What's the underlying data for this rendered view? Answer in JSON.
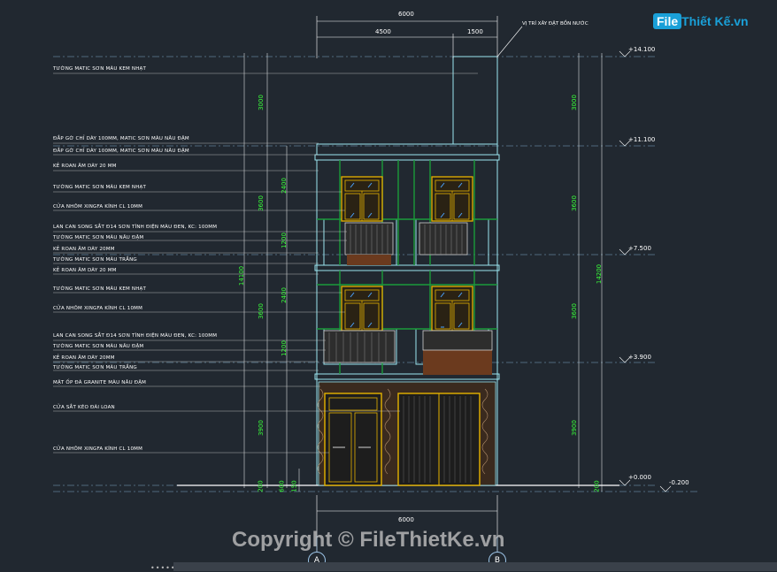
{
  "logo": {
    "file": "File",
    "rest": "Thiết Kế.vn"
  },
  "copyright": "Copyright © FileThietKe.vn",
  "top_note": "VỊ TRÍ XÂY ĐẶT BỒN NƯỚC",
  "dims_top": {
    "overall": "6000",
    "left": "4500",
    "right": "1500"
  },
  "dims_bottom": {
    "overall": "6000"
  },
  "levels": [
    {
      "key": "l14",
      "text": "+14.100"
    },
    {
      "key": "l11",
      "text": "+11.100"
    },
    {
      "key": "l7",
      "text": "+7.500"
    },
    {
      "key": "l3",
      "text": "+3.900"
    },
    {
      "key": "l0",
      "text": "+0.000"
    },
    {
      "key": "lm",
      "text": "-0.200"
    }
  ],
  "vdims_left": [
    "3000",
    "2400",
    "3600",
    "1200",
    "14100",
    "2400",
    "3600",
    "1200",
    "3900",
    "200",
    "600",
    "150"
  ],
  "vdims_right": [
    "3000",
    "3600",
    "3600",
    "3900",
    "14200",
    "200"
  ],
  "axes": {
    "a": "A",
    "b": "B"
  },
  "labels": [
    "TƯỜNG MATIC SƠN MÀU KEM NHẠT",
    "ĐẮP GỜ CHỈ DÀY 100MM, MATIC SƠN MÀU NÂU ĐẬM",
    "ĐẮP GỜ CHỈ DÀY 100MM, MATIC SƠN MÀU NÂU ĐẬM",
    "KẺ ROAN ÂM DÀY 20 MM",
    "TƯỜNG MATIC SƠN MÀU KEM NHẠT",
    "CỬA NHÔM XINGFA KÍNH CL 10MM",
    "LAN CAN SONG SẮT Đ14 SƠN TĨNH ĐIỆN MÀU ĐEN, KC: 100MM",
    "TƯỜNG MATIC SƠN MÀU NÂU ĐẬM",
    "KẺ ROAN ÂM DÀY 20MM",
    "TƯỜNG MATIC SƠN MÀU TRẮNG",
    "KẺ ROAN ÂM DÀY 20 MM",
    "TƯỜNG MATIC SƠN MÀU KEM NHẠT",
    "CỬA NHÔM XINGFA KÍNH CL 10MM",
    "LAN CAN SONG SẮT Đ14 SƠN TĨNH ĐIỆN MÀU ĐEN, KC: 100MM",
    "TƯỜNG MATIC SƠN MÀU NÂU ĐẬM",
    "KẺ ROAN ÂM DÀY 20MM",
    "TƯỜNG MATIC SƠN MÀU TRẮNG",
    "MẶT ỐP ĐÁ GRANITE MÀU NÂU ĐẬM",
    "CỬA SẮT KÉO ĐÀI LOAN",
    "CỬA NHÔM XINGFA KÍNH CL 10MM"
  ]
}
